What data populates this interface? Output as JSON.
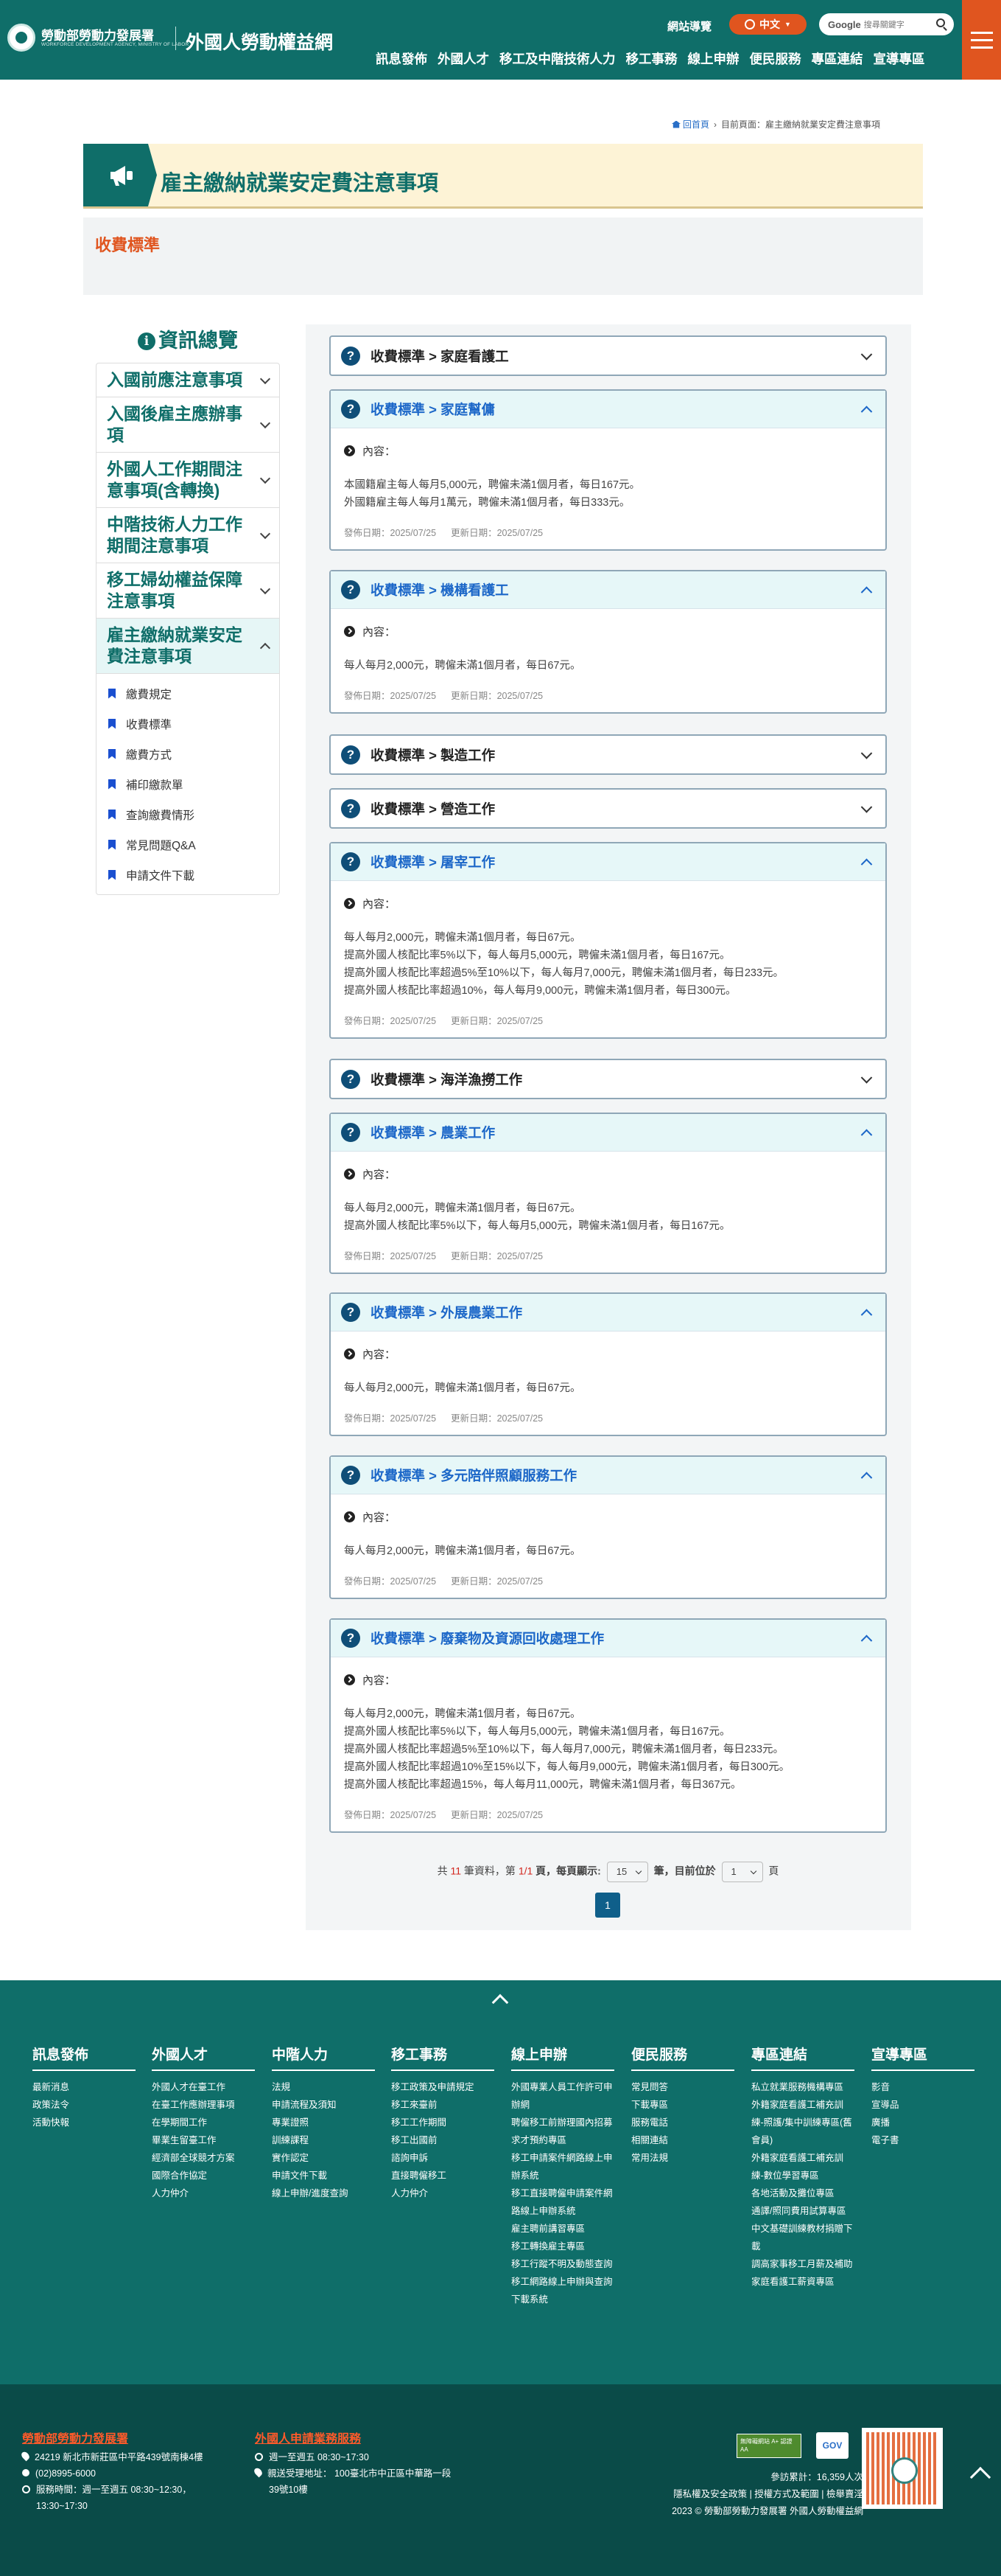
{
  "header": {
    "org_name": "勞動部勞動力發展署",
    "org_en": "WORKFORCE DEVELOPMENT AGENCY, MINISTRY OF LABOR",
    "site_title": "外國人勞動權益網",
    "sitemap": "網站導覽",
    "lang": "中文",
    "search_brand": "Google",
    "search_placeholder": "搜尋關鍵字",
    "nav": [
      "訊息發佈",
      "外國人才",
      "移工及中階技術人力",
      "移工事務",
      "線上申辦",
      "便民服務",
      "專區連結",
      "宣導專區"
    ]
  },
  "breadcrumb": {
    "home": "回首頁",
    "sep": "›",
    "current": "目前頁面：雇主繳納就業安定費注意事項"
  },
  "page_title": "雇主繳納就業安定費注意事項",
  "section_title": "收費標準",
  "sidebar": {
    "heading": "資訊總覽",
    "items": [
      "入國前應注意事項",
      "入國後雇主應辦事項",
      "外國人工作期間注意事項(含轉換)",
      "中階技術人力工作期間注意事項",
      "移工婦幼權益保障注意事項",
      "雇主繳納就業安定費注意事項"
    ],
    "subitems": [
      "繳費規定",
      "收費標準",
      "繳費方式",
      "補印繳款單",
      "查詢繳費情形",
      "常見問題Q&A",
      "申請文件下載"
    ]
  },
  "content_label": "內容：",
  "publish_label": "發佈日期：2025/07/25",
  "update_label": "更新日期：2025/07/25",
  "accordions": [
    {
      "title": "收費標準 > 家庭看護工",
      "open": false,
      "lines": []
    },
    {
      "title": "收費標準 > 家庭幫傭",
      "open": true,
      "lines": [
        "本國籍雇主每人每月5,000元，聘僱未滿1個月者，每日167元。",
        "外國籍雇主每人每月1萬元，聘僱未滿1個月者，每日333元。"
      ]
    },
    {
      "title": "收費標準 > 機構看護工",
      "open": true,
      "lines": [
        "每人每月2,000元，聘僱未滿1個月者，每日67元。"
      ]
    },
    {
      "title": "收費標準 > 製造工作",
      "open": false,
      "lines": []
    },
    {
      "title": "收費標準 > 營造工作",
      "open": false,
      "lines": []
    },
    {
      "title": "收費標準 > 屠宰工作",
      "open": true,
      "lines": [
        "每人每月2,000元，聘僱未滿1個月者，每日67元。",
        "提高外國人核配比率5%以下，每人每月5,000元，聘僱未滿1個月者，每日167元。",
        "提高外國人核配比率超過5%至10%以下，每人每月7,000元，聘僱未滿1個月者，每日233元。",
        "提高外國人核配比率超過10%，每人每月9,000元，聘僱未滿1個月者，每日300元。"
      ]
    },
    {
      "title": "收費標準 > 海洋漁撈工作",
      "open": false,
      "lines": []
    },
    {
      "title": "收費標準 > 農業工作",
      "open": true,
      "lines": [
        "每人每月2,000元，聘僱未滿1個月者，每日67元。",
        "提高外國人核配比率5%以下，每人每月5,000元，聘僱未滿1個月者，每日167元。"
      ]
    },
    {
      "title": "收費標準 > 外展農業工作",
      "open": true,
      "lines": [
        "每人每月2,000元，聘僱未滿1個月者，每日67元。"
      ]
    },
    {
      "title": "收費標準 > 多元陪伴照顧服務工作",
      "open": true,
      "lines": [
        "每人每月2,000元，聘僱未滿1個月者，每日67元。"
      ]
    },
    {
      "title": "收費標準 > 廢棄物及資源回收處理工作",
      "open": true,
      "lines": [
        "每人每月2,000元，聘僱未滿1個月者，每日67元。",
        "提高外國人核配比率5%以下，每人每月5,000元，聘僱未滿1個月者，每日167元。",
        "提高外國人核配比率超過5%至10%以下，每人每月7,000元，聘僱未滿1個月者，每日233元。",
        "提高外國人核配比率超過10%至15%以下，每人每月9,000元，聘僱未滿1個月者，每日300元。",
        "提高外國人核配比率超過15%，每人每月11,000元，聘僱未滿1個月者，每日367元。"
      ]
    }
  ],
  "pager": {
    "p1": "共",
    "total": "11",
    "p2": "筆資料，第",
    "page": "1/1",
    "p3": "頁，每頁顯示:",
    "per_page": "15",
    "p4": "筆，目前位於",
    "current": "1",
    "p5": "頁",
    "btn": "1"
  },
  "footer_cols": [
    {
      "title": "訊息發佈",
      "items": [
        "最新消息",
        "政策法令",
        "活動快報"
      ]
    },
    {
      "title": "外國人才",
      "items": [
        "外國人才在臺工作",
        "在臺工作應辦理事項",
        "在學期間工作",
        "畢業生留臺工作",
        "經濟部全球競才方案",
        "國際合作協定",
        "人力仲介"
      ]
    },
    {
      "title": "中階人力",
      "items": [
        "法規",
        "申請流程及須知",
        "專業證照",
        "訓練課程",
        "實作認定",
        "申請文件下載",
        "線上申辦/進度查詢"
      ]
    },
    {
      "title": "移工事務",
      "items": [
        "移工政策及申請規定",
        "移工來臺前",
        "移工工作期間",
        "移工出國前",
        "諮詢申訴",
        "直接聘僱移工",
        "人力仲介"
      ]
    },
    {
      "title": "線上申辦",
      "items": [
        "外國專業人員工作許可申辦網",
        "聘僱移工前辦理國內招募求才預約專區",
        "移工申請案件網路線上申辦系統",
        "移工直接聘僱申請案件網路線上申辦系統",
        "雇主聘前講習專區",
        "移工轉換雇主專區",
        "移工行蹤不明及動態查詢",
        "移工網路線上申辦與查詢下載系統"
      ]
    },
    {
      "title": "便民服務",
      "items": [
        "常見問答",
        "下載專區",
        "服務電話",
        "相關連結",
        "常用法規"
      ]
    },
    {
      "title": "專區連結",
      "items": [
        "私立就業服務機構專區",
        "外籍家庭看護工補充訓練-照護/集中訓練專區(舊會員)",
        "外籍家庭看護工補充訓練-數位學習專區",
        "各地活動及攤位專區",
        "通譯/照同費用試算專區",
        "中文基礎訓練教材捐贈下載",
        "調高家事移工月薪及補助家庭看護工薪資專區"
      ]
    },
    {
      "title": "宣導專區",
      "items": [
        "影音",
        "宣導品",
        "廣播",
        "電子書"
      ]
    }
  ],
  "footer_bottom": {
    "org1": "勞動部勞動力發展署",
    "addr1": "24219 新北市新莊區中平路439號南棟4樓",
    "tel1": "(02)8995-6000",
    "hours1a": "服務時間：週一至週五 08:30~12:30，",
    "hours1b": "13:30~17:30",
    "org2": "外國人申請業務服務",
    "hours2": "週一至週五 08:30~17:30",
    "addr2a": "親送受理地址： 100臺北市中正區中華路一段",
    "addr2b": "39號10樓",
    "badge1": "無障礙網站 A+ 認證 AA",
    "badge2": "GOV",
    "visits": "參訪累計：16,359人次",
    "links": "隱私權及安全政策 | 授權方式及範圍 | 檢舉賣淫",
    "copyright": "2023 © 勞動部勞動力發展署 外國人勞動權益網"
  },
  "colors": {
    "brand": "#0f6e69",
    "accent": "#e0551f",
    "link": "#1c67c8"
  }
}
